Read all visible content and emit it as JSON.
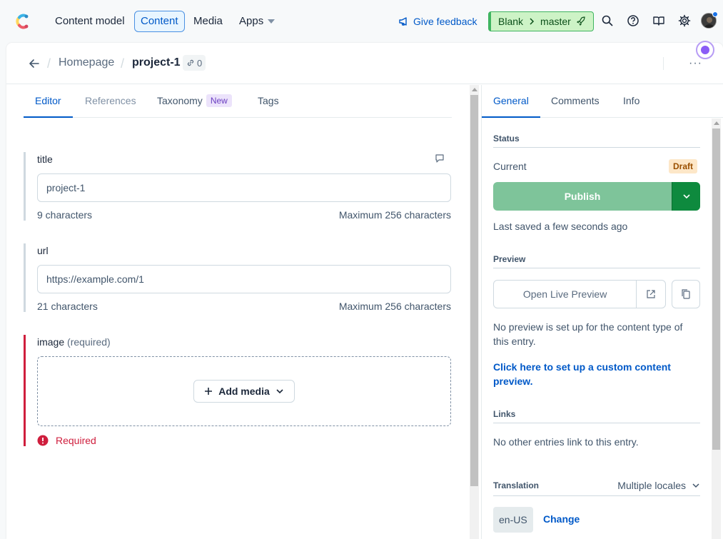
{
  "topnav": {
    "items": [
      {
        "label": "Content model",
        "active": false
      },
      {
        "label": "Content",
        "active": true
      },
      {
        "label": "Media",
        "active": false
      },
      {
        "label": "Apps",
        "active": false
      }
    ],
    "feedback_label": "Give feedback",
    "env": {
      "space": "Blank",
      "branch": "master"
    },
    "icons": [
      "search-icon",
      "help-icon",
      "book-icon",
      "gear-icon"
    ],
    "colors": {
      "accent": "#0059c8",
      "env_bg": "#cdf3c6",
      "env_border": "#3fb560"
    }
  },
  "breadcrumb": {
    "home": "Homepage",
    "current": "project-1",
    "link_count": "0"
  },
  "editor": {
    "tabs": [
      {
        "label": "Editor",
        "active": true
      },
      {
        "label": "References",
        "active": false,
        "disabled": true
      },
      {
        "label": "Taxonomy",
        "badge": "New"
      },
      {
        "label": "Tags"
      }
    ],
    "fields": {
      "title": {
        "label": "title",
        "value": "project-1",
        "count": "9 characters",
        "max": "Maximum 256 characters"
      },
      "url": {
        "label": "url",
        "value": "https://example.com/1",
        "count": "21 characters",
        "max": "Maximum 256 characters"
      },
      "image": {
        "label": "image",
        "required_label": "(required)",
        "add_media": "Add media",
        "error": "Required"
      }
    }
  },
  "sidebar": {
    "tabs": [
      {
        "label": "General",
        "active": true
      },
      {
        "label": "Comments"
      },
      {
        "label": "Info"
      }
    ],
    "status": {
      "heading": "Status",
      "current_label": "Current",
      "badge": "Draft",
      "publish_label": "Publish",
      "last_saved": "Last saved a few seconds ago"
    },
    "preview": {
      "heading": "Preview",
      "button_label": "Open Live Preview",
      "note": "No preview is set up for the content type of this entry.",
      "custom_link": "Click here to set up a custom content preview."
    },
    "links": {
      "heading": "Links",
      "note": "No other entries link to this entry."
    },
    "translation": {
      "heading": "Translation",
      "selector": "Multiple locales",
      "locale": "en-US",
      "change_label": "Change"
    }
  }
}
